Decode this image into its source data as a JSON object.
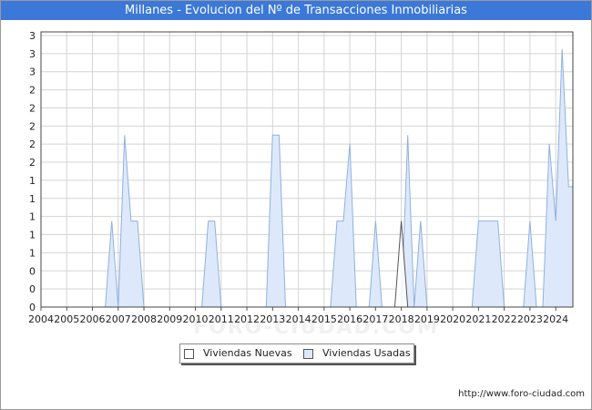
{
  "title": "Millanes - Evolucion del Nº de Transacciones Inmobiliarias",
  "source": "http://www.foro-ciudad.com",
  "watermark": "FORO-CIUDAD.COM",
  "colors": {
    "title_bg": "#3b78d8",
    "nuevas_fill": "#ffffff",
    "nuevas_stroke": "#555555",
    "usadas_fill": "#dde9fb",
    "usadas_stroke": "#8fb0e0",
    "grid": "#d4d4d4"
  },
  "chart_data": {
    "type": "area",
    "x_start": "2004-01",
    "x_end": "2024-09",
    "x_ticks": [
      "2004",
      "2005",
      "2006",
      "2007",
      "2008",
      "2009",
      "2010",
      "2011",
      "2012",
      "2013",
      "2014",
      "2015",
      "2016",
      "2017",
      "2018",
      "2019",
      "2020",
      "2021",
      "2022",
      "2023",
      "2024"
    ],
    "y_tick_labels": [
      "0",
      "0",
      "0",
      "1",
      "1",
      "1",
      "1",
      "1",
      "2",
      "2",
      "2",
      "2",
      "2",
      "3",
      "3",
      "3"
    ],
    "ylim": [
      0,
      3.2
    ],
    "grid": true,
    "legend_position": "bottom",
    "series": [
      {
        "name": "Viviendas Nuevas",
        "points": [
          [
            "2017-10",
            0
          ],
          [
            "2018-01",
            1
          ],
          [
            "2018-04",
            0
          ]
        ]
      },
      {
        "name": "Viviendas Usadas",
        "points": [
          [
            "2006-07",
            0
          ],
          [
            "2006-10",
            1
          ],
          [
            "2007-01",
            0
          ],
          [
            "2007-04",
            2
          ],
          [
            "2007-07",
            1
          ],
          [
            "2007-10",
            1
          ],
          [
            "2008-01",
            0
          ],
          [
            "2010-04",
            0
          ],
          [
            "2010-07",
            1
          ],
          [
            "2010-10",
            1
          ],
          [
            "2011-01",
            0
          ],
          [
            "2012-10",
            0
          ],
          [
            "2013-01",
            2
          ],
          [
            "2013-04",
            2
          ],
          [
            "2013-07",
            0
          ],
          [
            "2015-04",
            0
          ],
          [
            "2015-07",
            1
          ],
          [
            "2015-10",
            1
          ],
          [
            "2016-01",
            1.9
          ],
          [
            "2016-04",
            0
          ],
          [
            "2016-10",
            0
          ],
          [
            "2017-01",
            1
          ],
          [
            "2017-04",
            0
          ],
          [
            "2018-01",
            0
          ],
          [
            "2018-04",
            2
          ],
          [
            "2018-07",
            0
          ],
          [
            "2018-10",
            1
          ],
          [
            "2019-01",
            0
          ],
          [
            "2020-10",
            0
          ],
          [
            "2021-01",
            1
          ],
          [
            "2021-04",
            1
          ],
          [
            "2021-07",
            1
          ],
          [
            "2021-10",
            1
          ],
          [
            "2022-01",
            0
          ],
          [
            "2022-10",
            0
          ],
          [
            "2023-01",
            1
          ],
          [
            "2023-04",
            0
          ],
          [
            "2023-07",
            0
          ],
          [
            "2023-10",
            1.9
          ],
          [
            "2024-01",
            1
          ],
          [
            "2024-04",
            3
          ],
          [
            "2024-07",
            1.4
          ],
          [
            "2024-09",
            1.4
          ]
        ]
      }
    ]
  }
}
